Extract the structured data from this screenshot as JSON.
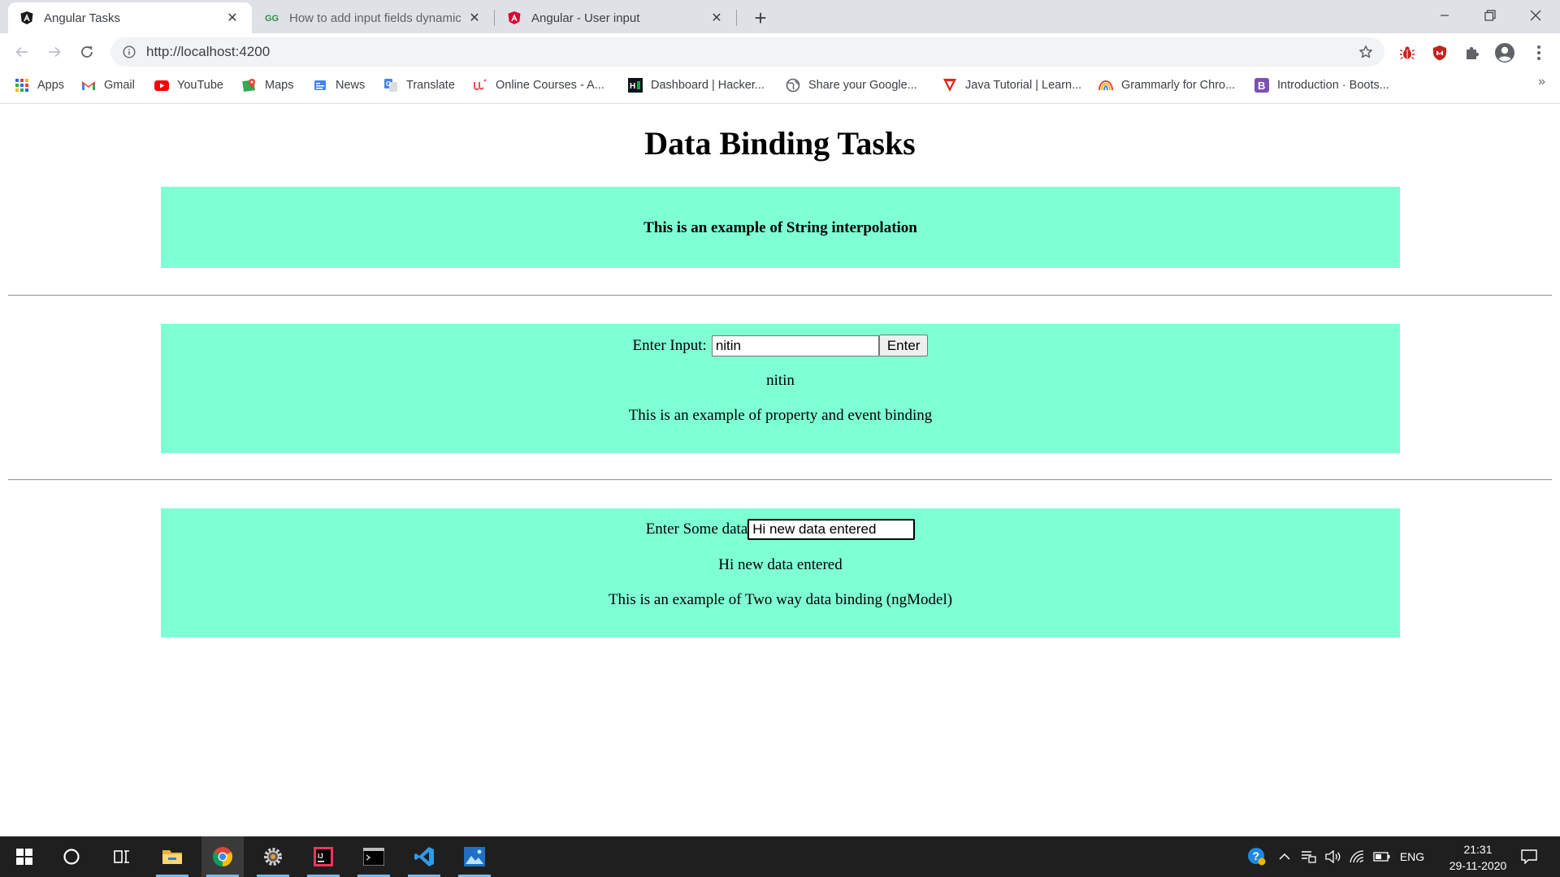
{
  "browser": {
    "tabs": [
      {
        "title": "Angular Tasks",
        "icon": "angular-icon",
        "active": true
      },
      {
        "title": "How to add input fields dynamic",
        "icon": "geeksforgeeks-icon",
        "active": false
      },
      {
        "title": "Angular - User input",
        "icon": "angular-red-icon",
        "active": false
      }
    ],
    "url": "http://localhost:4200",
    "bookmarks": [
      {
        "label": "Apps",
        "icon": "apps-grid-icon"
      },
      {
        "label": "Gmail",
        "icon": "gmail-icon"
      },
      {
        "label": "YouTube",
        "icon": "youtube-icon"
      },
      {
        "label": "Maps",
        "icon": "maps-icon"
      },
      {
        "label": "News",
        "icon": "news-icon"
      },
      {
        "label": "Translate",
        "icon": "translate-icon"
      },
      {
        "label": "Online Courses - A...",
        "icon": "udemy-icon"
      },
      {
        "label": "Dashboard | Hacker...",
        "icon": "hackerrank-icon"
      },
      {
        "label": "Share your Google...",
        "icon": "globe-icon"
      },
      {
        "label": "Java Tutorial | Learn...",
        "icon": "javatpoint-icon"
      },
      {
        "label": "Grammarly for Chro...",
        "icon": "grammarly-icon"
      },
      {
        "label": "Introduction · Boots...",
        "icon": "bootstrap-icon"
      }
    ],
    "bookmarks_more": "»"
  },
  "page": {
    "heading": "Data Binding Tasks",
    "interpolation_text": "This is an example of String interpolation",
    "section2": {
      "label": "Enter Input:",
      "input_value": "nitin",
      "button_label": "Enter",
      "output": "nitin",
      "description": "This is an example of property and event binding"
    },
    "section3": {
      "label": "Enter Some data",
      "input_value": "Hi new data entered",
      "output": "Hi new data entered",
      "description": "This is an example of Two way data binding (ngModel)"
    },
    "panel_color": "#7fffd4"
  },
  "taskbar": {
    "language": "ENG",
    "time": "21:31",
    "date": "29-11-2020"
  }
}
